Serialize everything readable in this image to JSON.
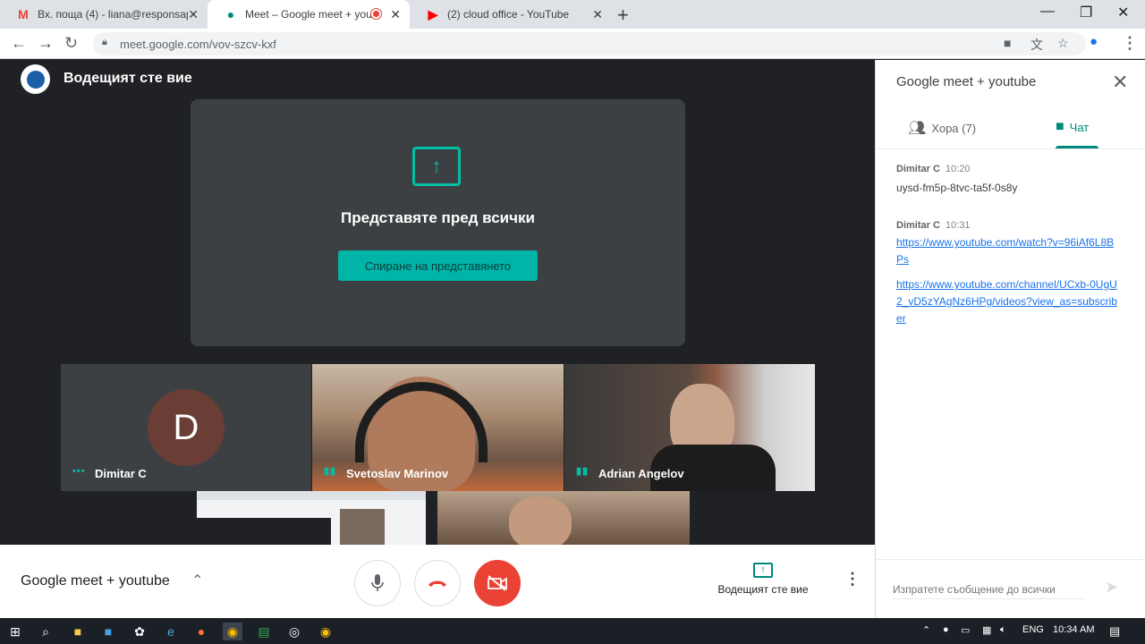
{
  "browser": {
    "tabs": [
      {
        "label": "Вх. поща (4) - liana@responsapr...",
        "icon": "gmail-icon",
        "active": false
      },
      {
        "label": "Meet – Google meet + youtu...",
        "icon": "meet-icon",
        "active": true
      },
      {
        "label": "(2) cloud office - YouTube",
        "icon": "youtube-icon",
        "active": false
      }
    ],
    "url": "meet.google.com/vov-szcv-kxf"
  },
  "stage": {
    "presenter_title": "Водещият сте вие",
    "present_message": "Представяте пред всички",
    "stop_button": "Спиране на представянето",
    "participants": [
      {
        "name": "Dimitar C",
        "initial": "D"
      },
      {
        "name": "Svetoslav Marinov"
      },
      {
        "name": "Adrian Angelov"
      }
    ]
  },
  "bottombar": {
    "meeting_title": "Google meet + youtube",
    "present_label": "Водещият сте вие",
    "end_color": "#ea4335"
  },
  "panel": {
    "title": "Google meet + youtube",
    "people_tab": "Хора (7)",
    "chat_tab": "Чат",
    "messages": [
      {
        "sender": "Dimitar C",
        "time": "10:20",
        "text": "uysd-fm5p-8tvc-ta5f-0s8y"
      },
      {
        "sender": "Dimitar C",
        "time": "10:31",
        "link1": "https://www.youtube.com/watch?v=96iAf6L8BPs",
        "link2": "https://www.youtube.com/channel/UCxb-0UgU2_vD5zYAgNz6HPg/videos?view_as=subscriber"
      }
    ],
    "compose_placeholder": "Изпратете съобщение до всички"
  },
  "taskbar": {
    "lang": "ENG",
    "time": "10:34 AM"
  },
  "accent": "#00897b"
}
